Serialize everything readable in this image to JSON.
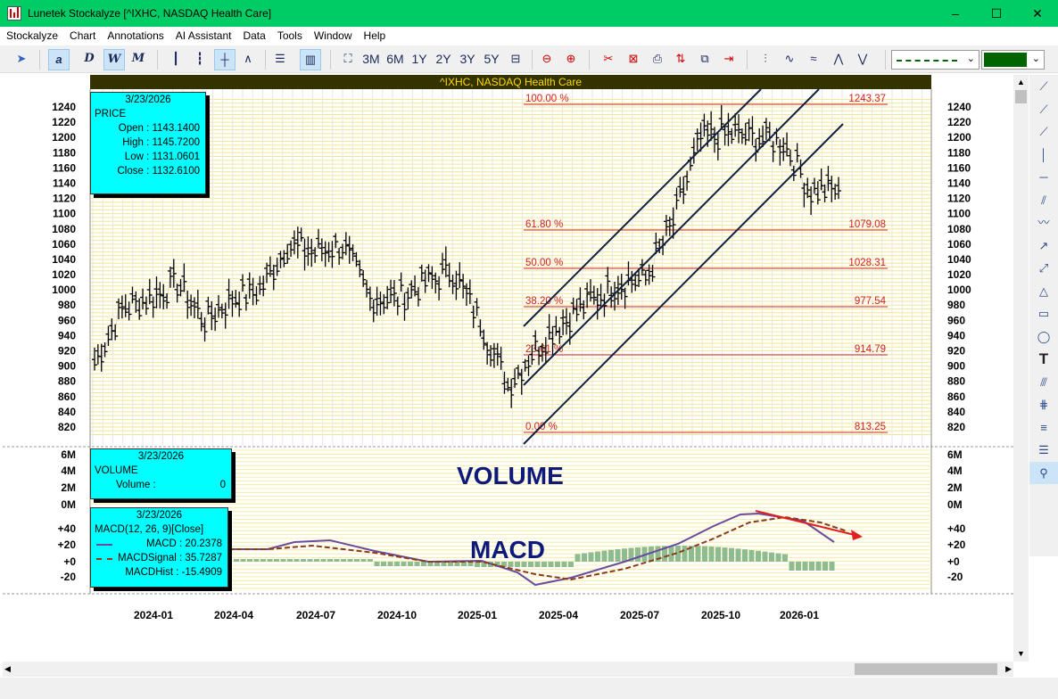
{
  "window": {
    "title": "Lunetek Stockalyze [^IXHC, NASDAQ Health Care]",
    "minimize": "–",
    "maximize": "☐",
    "close": "✕"
  },
  "menu": [
    "Stockalyze",
    "Chart",
    "Annotations",
    "AI Assistant",
    "Data",
    "Tools",
    "Window",
    "Help"
  ],
  "toolbar": {
    "period_buttons": [
      "3M",
      "6M",
      "1Y",
      "2Y",
      "3Y",
      "5Y"
    ],
    "font_buttons": [
      "a",
      "D",
      "W",
      "M"
    ],
    "line_color": "#006400"
  },
  "chart": {
    "header": "^IXHC, NASDAQ Health Care",
    "volume_label": "VOLUME",
    "macd_label": "MACD",
    "price_ticks": [
      "1240",
      "1220",
      "1200",
      "1180",
      "1160",
      "1140",
      "1120",
      "1100",
      "1080",
      "1060",
      "1040",
      "1020",
      "1000",
      "980",
      "960",
      "940",
      "920",
      "900",
      "880",
      "860",
      "840",
      "820"
    ],
    "volume_ticks": [
      "6M",
      "4M",
      "2M",
      "0M"
    ],
    "macd_ticks": [
      "+40",
      "+20",
      "+0",
      "-20"
    ],
    "x_ticks": [
      "2024-01",
      "2024-04",
      "2024-07",
      "2024-10",
      "2025-01",
      "2025-04",
      "2025-07",
      "2025-10",
      "2026-01"
    ],
    "fib_levels": [
      {
        "pct": "100.00 %",
        "value": "1243.37"
      },
      {
        "pct": "61.80 %",
        "value": "1079.08"
      },
      {
        "pct": "50.00 %",
        "value": "1028.31"
      },
      {
        "pct": "38.20 %",
        "value": "977.54"
      },
      {
        "pct": "23.61 %",
        "value": "914.79"
      },
      {
        "pct": "0.00 %",
        "value": "813.25"
      }
    ]
  },
  "price_box": {
    "date": "3/23/2026",
    "title": "PRICE",
    "open": "Open : 1143.1400",
    "high": "High : 1145.7200",
    "low": "Low : 1131.0601",
    "close": "Close : 1132.6100"
  },
  "volume_box": {
    "date": "3/23/2026",
    "title": "VOLUME",
    "volume_label": "Volume :",
    "volume_value": "0"
  },
  "macd_box": {
    "date": "3/23/2026",
    "title": "MACD(12, 26, 9)[Close]",
    "macd": "MACD : 20.2378",
    "signal": "MACDSignal : 35.7287",
    "hist": "MACDHist : -15.4909"
  },
  "chart_data": {
    "type": "line",
    "x": [
      "2023-12",
      "2024-01",
      "2024-02",
      "2024-03",
      "2024-04",
      "2024-05",
      "2024-06",
      "2024-07",
      "2024-08",
      "2024-09",
      "2024-10",
      "2024-11",
      "2024-12",
      "2025-01",
      "2025-02",
      "2025-03",
      "2025-04",
      "2025-05",
      "2025-06",
      "2025-07",
      "2025-08",
      "2025-09",
      "2025-10",
      "2025-11",
      "2025-12",
      "2026-01",
      "2026-02",
      "2026-03"
    ],
    "series": [
      {
        "values": [
          905,
          975,
          990,
          1010,
          960,
          990,
          1000,
          1060,
          1050,
          1060,
          990,
          990,
          1010,
          1025,
          960,
          875,
          925,
          960,
          985,
          1010,
          1015,
          1090,
          1200,
          1205,
          1200,
          1195,
          1130,
          1133
        ]
      }
    ],
    "ylim": [
      810,
      1250
    ]
  }
}
